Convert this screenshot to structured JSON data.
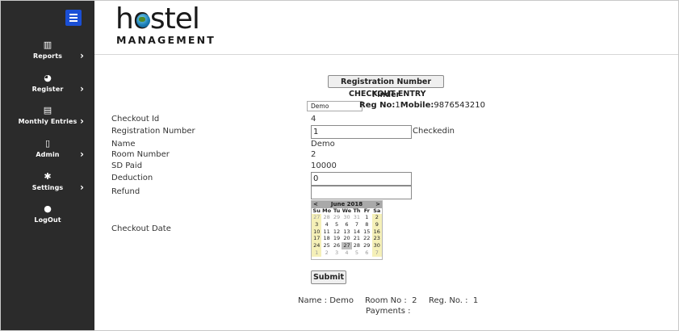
{
  "sidebar": {
    "items": [
      {
        "label": "Reports",
        "icon": "bar-chart-icon",
        "glyph": "▥",
        "chevron": "›"
      },
      {
        "label": "Register",
        "icon": "dashboard-icon",
        "glyph": "◕",
        "chevron": "›"
      },
      {
        "label": "Monthly Entries",
        "icon": "book-icon",
        "glyph": "▤",
        "chevron": "›"
      },
      {
        "label": "Admin",
        "icon": "file-icon",
        "glyph": "▯",
        "chevron": "›"
      },
      {
        "label": "Settings",
        "icon": "gear-icon",
        "glyph": "✱",
        "chevron": "›"
      },
      {
        "label": "LogOut",
        "icon": "map-marker-icon",
        "glyph": "●",
        "chevron": ""
      }
    ]
  },
  "header": {
    "logo_main": "hostel",
    "logo_sub": "MANAGEMENT"
  },
  "finder_button": "Registration Number Finder",
  "section_title": "CHECKOUT ENTRY",
  "select": {
    "value": "Demo"
  },
  "reg_info": {
    "reg_label": "Reg No:",
    "reg_value": "1",
    "mobile_label": "Mobile:",
    "mobile_value": "9876543210"
  },
  "form": {
    "checkout_id": {
      "label": "Checkout Id",
      "value": "4"
    },
    "registration_number": {
      "label": "Registration Number",
      "value": "1",
      "status": "Checkedin"
    },
    "name": {
      "label": "Name",
      "value": "Demo"
    },
    "room_number": {
      "label": "Room Number",
      "value": "2"
    },
    "sd_paid": {
      "label": "SD Paid",
      "value": "10000"
    },
    "deduction": {
      "label": "Deduction",
      "value": "0"
    },
    "refund": {
      "label": "Refund",
      "value": ""
    },
    "checkout_date": {
      "label": "Checkout Date"
    }
  },
  "calendar": {
    "title": "June 2018",
    "prev": "<",
    "next": ">",
    "weekdays": [
      "Su",
      "Mo",
      "Tu",
      "We",
      "Th",
      "Fr",
      "Sa"
    ],
    "weeks": [
      [
        "27",
        "28",
        "29",
        "30",
        "31",
        "1",
        "2"
      ],
      [
        "3",
        "4",
        "5",
        "6",
        "7",
        "8",
        "9"
      ],
      [
        "10",
        "11",
        "12",
        "13",
        "14",
        "15",
        "16"
      ],
      [
        "17",
        "18",
        "19",
        "20",
        "21",
        "22",
        "23"
      ],
      [
        "24",
        "25",
        "26",
        "27",
        "28",
        "29",
        "30"
      ],
      [
        "1",
        "2",
        "3",
        "4",
        "5",
        "6",
        "7"
      ]
    ],
    "selected_day": "27",
    "weekend_color": "#f5f0b8",
    "header_color": "#a9a9a9"
  },
  "submit_button": "Submit",
  "summary": {
    "name_text": "Name : Demo",
    "room_text": "Room No :  2",
    "reg_text": "Reg. No. :  1",
    "payments_text": "Payments :"
  },
  "colors": {
    "sidebar_bg": "#2b2b2b",
    "menu_toggle": "#1a4fd6"
  }
}
